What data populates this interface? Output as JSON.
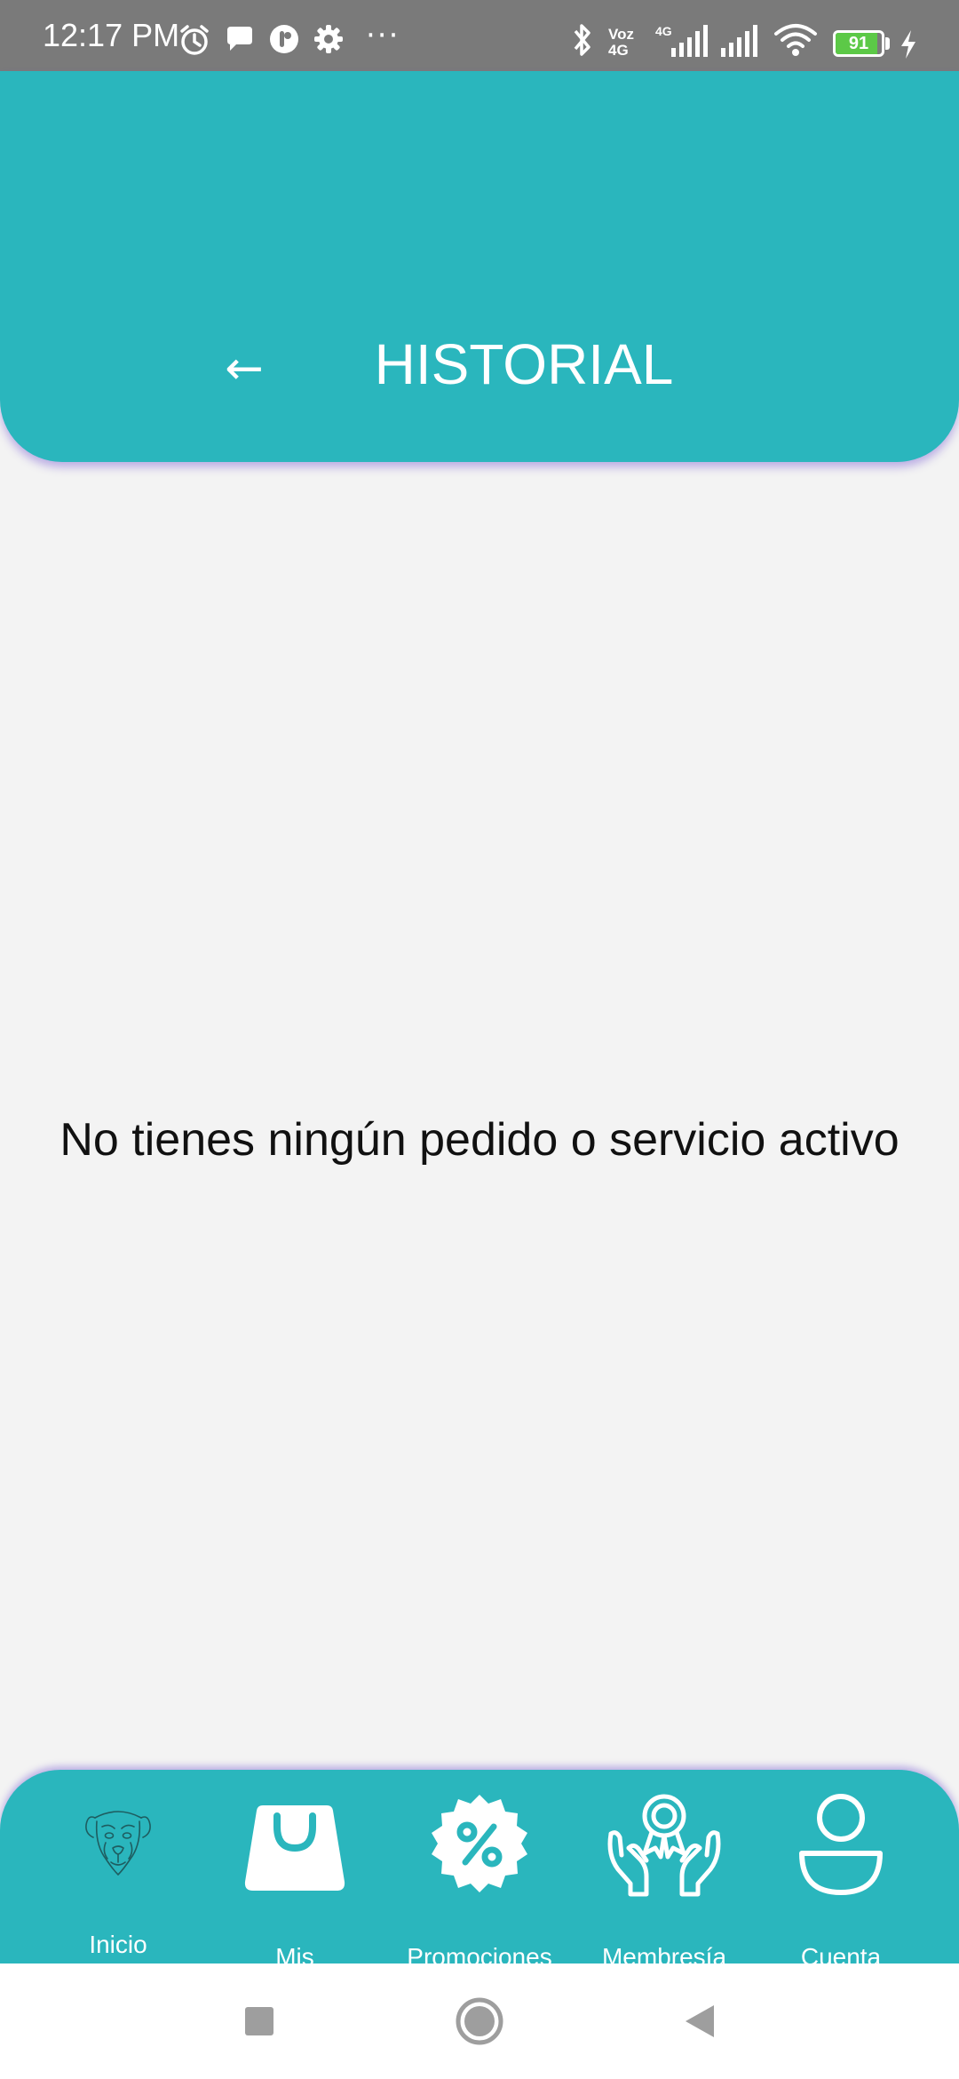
{
  "status_bar": {
    "time": "12:17 PM",
    "battery_level": 91,
    "battery_text": "91",
    "volte_label_top": "Voz",
    "volte_label_bottom": "4G",
    "network_label": "4G",
    "more_indicator": "···",
    "left_icons": [
      "alarm-icon",
      "chat-bubble-icon",
      "app-notification-icon",
      "settings-icon"
    ],
    "right_icons": [
      "bluetooth-icon",
      "signal-icon",
      "signal-icon",
      "wifi-icon",
      "battery-icon",
      "charging-icon"
    ]
  },
  "header": {
    "back_icon": "←",
    "title": "HISTORIAL"
  },
  "main": {
    "empty_message": "No tienes ningún pedido o servicio activo"
  },
  "bottom_nav": {
    "items": [
      {
        "label": "Inicio",
        "icon": "dog-logo-icon"
      },
      {
        "label": "Mis",
        "icon": "shopping-bag-icon"
      },
      {
        "label": "Promociones",
        "icon": "percent-badge-icon"
      },
      {
        "label": "Membresía",
        "icon": "award-hands-icon"
      },
      {
        "label": "Cuenta",
        "icon": "user-icon"
      }
    ]
  },
  "colors": {
    "accent": "#2ab6bd",
    "background": "#f3f3f3",
    "status_bar": "#7a7a7a",
    "battery_fill": "#5cc947"
  },
  "system_nav": {
    "buttons": [
      "recents-button",
      "home-button",
      "back-button"
    ]
  }
}
